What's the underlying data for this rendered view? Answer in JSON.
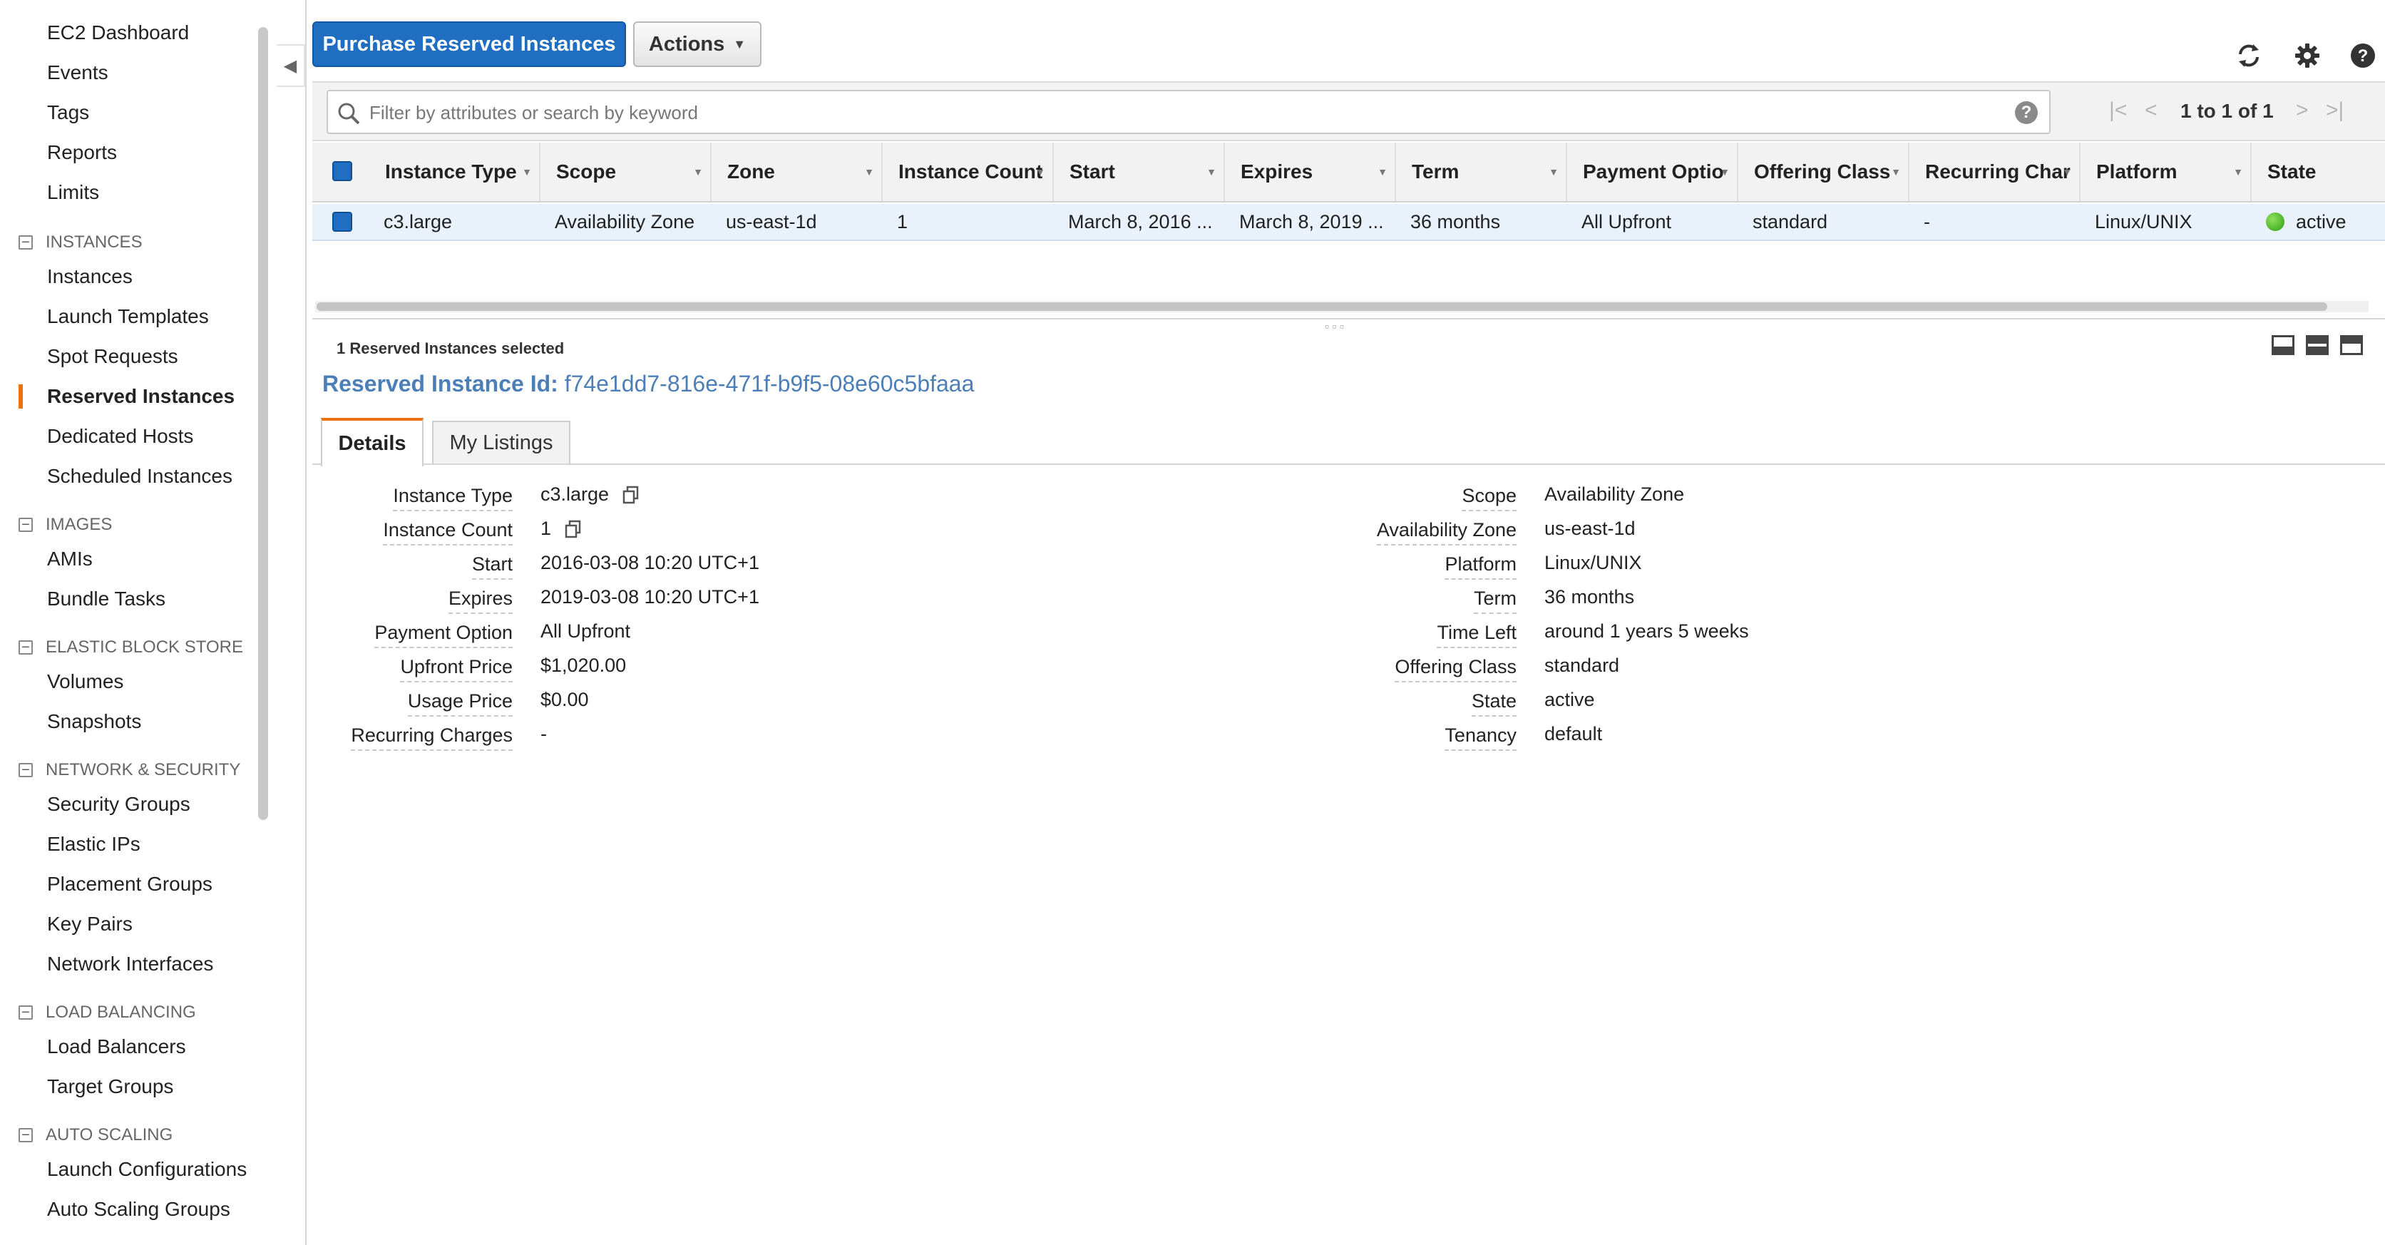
{
  "sidebar": {
    "items": [
      {
        "label": "EC2 Dashboard"
      },
      {
        "label": "Events"
      },
      {
        "label": "Tags"
      },
      {
        "label": "Reports"
      },
      {
        "label": "Limits"
      }
    ],
    "sections": [
      {
        "title": "INSTANCES",
        "items": [
          "Instances",
          "Launch Templates",
          "Spot Requests",
          "Reserved Instances",
          "Dedicated Hosts",
          "Scheduled Instances"
        ]
      },
      {
        "title": "IMAGES",
        "items": [
          "AMIs",
          "Bundle Tasks"
        ]
      },
      {
        "title": "ELASTIC BLOCK STORE",
        "items": [
          "Volumes",
          "Snapshots"
        ]
      },
      {
        "title": "NETWORK & SECURITY",
        "items": [
          "Security Groups",
          "Elastic IPs",
          "Placement Groups",
          "Key Pairs",
          "Network Interfaces"
        ]
      },
      {
        "title": "LOAD BALANCING",
        "items": [
          "Load Balancers",
          "Target Groups"
        ]
      },
      {
        "title": "AUTO SCALING",
        "items": [
          "Launch Configurations",
          "Auto Scaling Groups"
        ]
      }
    ],
    "active_item": "Reserved Instances"
  },
  "toolbar": {
    "purchase_label": "Purchase Reserved Instances",
    "actions_label": "Actions"
  },
  "search": {
    "placeholder": "Filter by attributes or search by keyword"
  },
  "pagination": {
    "text": "1 to 1 of 1"
  },
  "table": {
    "columns": [
      "Instance Type",
      "Scope",
      "Zone",
      "Instance Count",
      "Start",
      "Expires",
      "Term",
      "Payment Optio",
      "Offering Class",
      "Recurring Char",
      "Platform",
      "State"
    ],
    "rows": [
      {
        "instance_type": "c3.large",
        "scope": "Availability Zone",
        "zone": "us-east-1d",
        "instance_count": "1",
        "start": "March 8, 2016 ...",
        "expires": "March 8, 2019 ...",
        "term": "36 months",
        "payment_option": "All Upfront",
        "offering_class": "standard",
        "recurring_charges": "-",
        "platform": "Linux/UNIX",
        "state": "active"
      }
    ]
  },
  "details": {
    "selected_text": "1 Reserved Instances selected",
    "id_label": "Reserved Instance Id:",
    "id_value": "f74e1dd7-816e-471f-b9f5-08e60c5bfaaa",
    "tabs": [
      "Details",
      "My Listings"
    ],
    "left": [
      {
        "label": "Instance Type",
        "value": "c3.large"
      },
      {
        "label": "Instance Count",
        "value": "1"
      },
      {
        "label": "Start",
        "value": "2016-03-08 10:20 UTC+1"
      },
      {
        "label": "Expires",
        "value": "2019-03-08 10:20 UTC+1"
      },
      {
        "label": "Payment Option",
        "value": "All Upfront"
      },
      {
        "label": "Upfront Price",
        "value": "$1,020.00"
      },
      {
        "label": "Usage Price",
        "value": "$0.00"
      },
      {
        "label": "Recurring Charges",
        "value": "-"
      }
    ],
    "right": [
      {
        "label": "Scope",
        "value": "Availability Zone"
      },
      {
        "label": "Availability Zone",
        "value": "us-east-1d"
      },
      {
        "label": "Platform",
        "value": "Linux/UNIX"
      },
      {
        "label": "Term",
        "value": "36 months"
      },
      {
        "label": "Time Left",
        "value": "around 1 years 5 weeks"
      },
      {
        "label": "Offering Class",
        "value": "standard"
      },
      {
        "label": "State",
        "value": "active"
      },
      {
        "label": "Tenancy",
        "value": "default"
      }
    ]
  },
  "colors": {
    "primary": "#1f6ec2",
    "accent": "#ec7211",
    "link": "#4c7fb8",
    "status_active": "#3aa81f"
  },
  "icons": [
    "refresh-icon",
    "gear-icon",
    "help-icon",
    "search-icon",
    "copy-icon",
    "chevron-down-icon",
    "first-page-icon",
    "prev-page-icon",
    "next-page-icon",
    "last-page-icon"
  ]
}
